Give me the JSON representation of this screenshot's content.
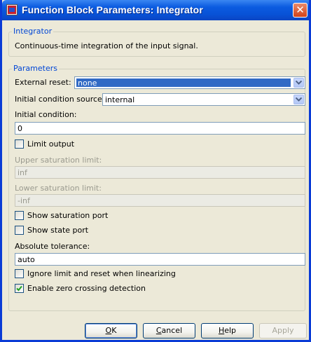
{
  "window": {
    "title": "Function Block Parameters: Integrator"
  },
  "block": {
    "group_title": "Integrator",
    "description": "Continuous-time integration of the input signal."
  },
  "parameters": {
    "group_title": "Parameters",
    "external_reset": {
      "label": "External reset:",
      "value": "none"
    },
    "initial_condition_source": {
      "label": "Initial condition source:",
      "value": "internal"
    },
    "initial_condition": {
      "label": "Initial condition:",
      "value": "0"
    },
    "limit_output": {
      "label": "Limit output",
      "checked": false
    },
    "upper_saturation_limit": {
      "label": "Upper saturation limit:",
      "value": "inf"
    },
    "lower_saturation_limit": {
      "label": "Lower saturation limit:",
      "value": "-inf"
    },
    "show_saturation_port": {
      "label": "Show saturation port",
      "checked": false
    },
    "show_state_port": {
      "label": "Show state port",
      "checked": false
    },
    "absolute_tolerance": {
      "label": "Absolute tolerance:",
      "value": "auto"
    },
    "ignore_limit_reset": {
      "label": "Ignore limit and reset when linearizing",
      "checked": false
    },
    "zero_crossing": {
      "label": "Enable zero crossing detection",
      "checked": true
    }
  },
  "buttons": {
    "ok": {
      "mnemonic": "O",
      "rest": "K"
    },
    "cancel": {
      "mnemonic": "C",
      "rest": "ancel"
    },
    "help": {
      "mnemonic": "H",
      "rest": "elp"
    },
    "apply": "Apply"
  },
  "colors": {
    "titlebar": "#0b5be0",
    "selection": "#316ac5",
    "legend_text": "#0046d5",
    "dialog_bg": "#ece9d8"
  }
}
